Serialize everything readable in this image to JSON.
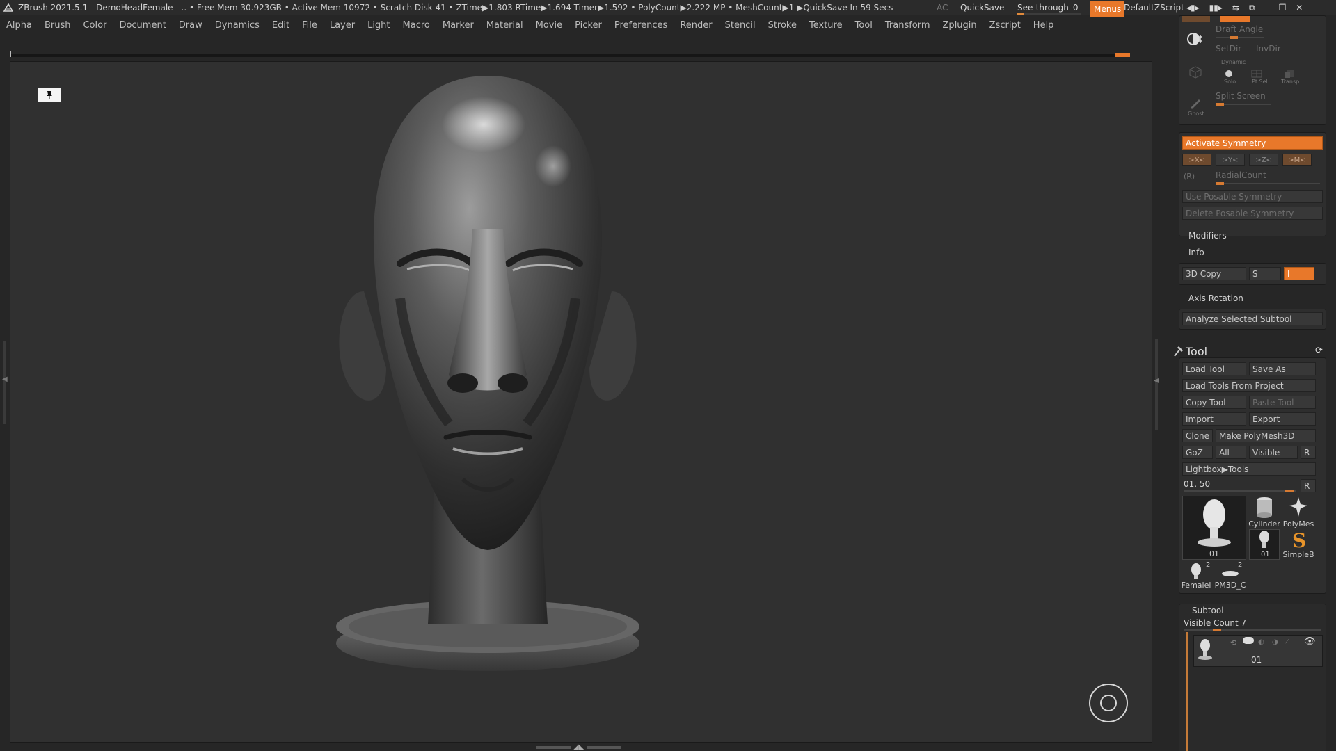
{
  "titlebar": {
    "app": "ZBrush 2021.5.1",
    "document": "DemoHeadFemale",
    "status": ".. • Free Mem 30.923GB • Active Mem 10972 • Scratch Disk 41 • ZTime▶1.803 RTime▶1.694 Timer▶1.592 • PolyCount▶2.222 MP • MeshCount▶1 ▶QuickSave In 59 Secs",
    "ac": "AC",
    "quicksave": "QuickSave",
    "see_through_label": "See-through",
    "see_through_value": "0",
    "menus": "Menus",
    "default_zscript": "DefaultZScript"
  },
  "menu": [
    "Alpha",
    "Brush",
    "Color",
    "Document",
    "Draw",
    "Dynamics",
    "Edit",
    "File",
    "Layer",
    "Light",
    "Macro",
    "Marker",
    "Material",
    "Movie",
    "Picker",
    "Preferences",
    "Render",
    "Stencil",
    "Stroke",
    "Texture",
    "Tool",
    "Transform",
    "Zplugin",
    "Zscript",
    "Help"
  ],
  "panel": {
    "draft_angle": "Draft Angle",
    "setdir": "SetDir",
    "invdir": "InvDir",
    "dynamic": "Dynamic",
    "solo": "Solo",
    "pt_sel": "Pt Sel",
    "transp": "Transp",
    "ghost": "Ghost",
    "split_screen": "Split Screen",
    "activate_symmetry": "Activate Symmetry",
    "sym_x": ">X<",
    "sym_y": ">Y<",
    "sym_z": ">Z<",
    "sym_m": ">M<",
    "sym_r": "(R)",
    "radial_count": "RadialCount",
    "use_posable": "Use Posable Symmetry",
    "delete_posable": "Delete Posable Symmetry",
    "modifiers": "Modifiers",
    "info": "Info",
    "copy3d": "3D Copy",
    "s": "S",
    "i": "I",
    "axis_rotation": "Axis Rotation",
    "analyze": "Analyze Selected Subtool"
  },
  "tool": {
    "title": "Tool",
    "load_tool": "Load Tool",
    "save_as": "Save As",
    "load_from_project": "Load Tools From Project",
    "copy_tool": "Copy Tool",
    "paste_tool": "Paste Tool",
    "import": "Import",
    "export": "Export",
    "clone": "Clone",
    "make_polymesh": "Make PolyMesh3D",
    "goz": "GoZ",
    "all": "All",
    "visible": "Visible",
    "r": "R",
    "lightbox_tools": "Lightbox▶Tools",
    "current_value": "01. 50",
    "thumbs": {
      "current": "01",
      "cylinder": "Cylinder",
      "polymesh": "PolyMes",
      "head_small": "01",
      "simpleb": "SimpleB",
      "female": "Femalel",
      "female_count": "2",
      "pm3d": "PM3D_C",
      "pm3d_count": "2"
    }
  },
  "subtool": {
    "title": "Subtool",
    "visible_count": "Visible Count 7",
    "item_name": "01"
  },
  "colors": {
    "accent": "#e8782a",
    "bg": "#262626",
    "canvas": "#303030"
  }
}
